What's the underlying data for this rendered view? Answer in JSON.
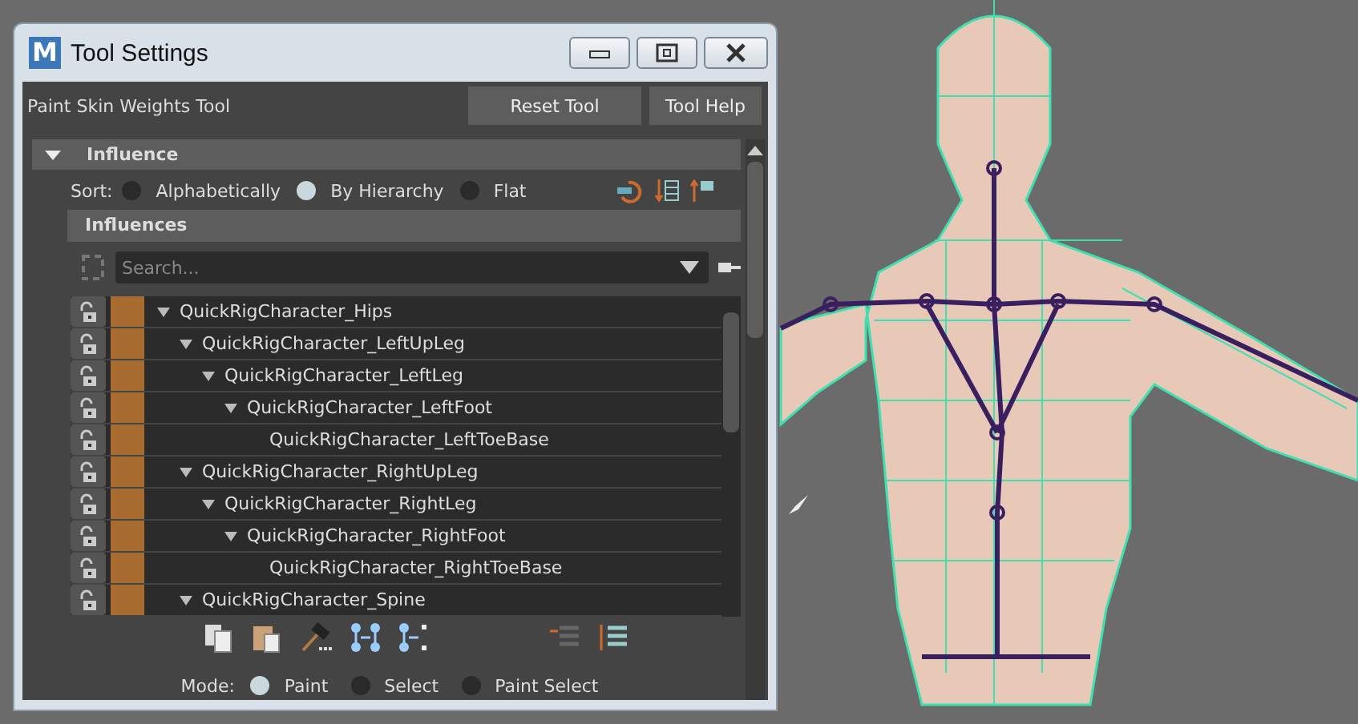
{
  "window": {
    "logo": "M",
    "title": "Tool Settings"
  },
  "tool": {
    "name": "Paint Skin Weights Tool",
    "buttons": [
      "Reset Tool",
      "Tool Help"
    ]
  },
  "influence_section": {
    "title": "Influence",
    "expanded": true,
    "sort": {
      "label": "Sort:",
      "options": [
        {
          "label": "Alphabetically",
          "selected": false
        },
        {
          "label": "By Hierarchy",
          "selected": true
        },
        {
          "label": "Flat",
          "selected": false
        }
      ]
    },
    "influences_header": "Influences",
    "search": {
      "placeholder": "Search..."
    },
    "tree": [
      {
        "label": "QuickRigCharacter_Hips",
        "expanded": true,
        "children": [
          {
            "label": "QuickRigCharacter_LeftUpLeg",
            "expanded": true,
            "children": [
              {
                "label": "QuickRigCharacter_LeftLeg",
                "expanded": true,
                "children": [
                  {
                    "label": "QuickRigCharacter_LeftFoot",
                    "expanded": true,
                    "children": [
                      {
                        "label": "QuickRigCharacter_LeftToeBase",
                        "expanded": false
                      }
                    ]
                  }
                ]
              }
            ]
          },
          {
            "label": "QuickRigCharacter_RightUpLeg",
            "expanded": true,
            "children": [
              {
                "label": "QuickRigCharacter_RightLeg",
                "expanded": true,
                "children": [
                  {
                    "label": "QuickRigCharacter_RightFoot",
                    "expanded": true,
                    "children": [
                      {
                        "label": "QuickRigCharacter_RightToeBase",
                        "expanded": false
                      }
                    ]
                  }
                ]
              }
            ]
          },
          {
            "label": "QuickRigCharacter_Spine",
            "expanded": true
          }
        ]
      }
    ],
    "mode": {
      "label": "Mode:",
      "options": [
        {
          "label": "Paint",
          "selected": true
        },
        {
          "label": "Select",
          "selected": false
        },
        {
          "label": "Paint Select",
          "selected": false
        }
      ]
    }
  }
}
